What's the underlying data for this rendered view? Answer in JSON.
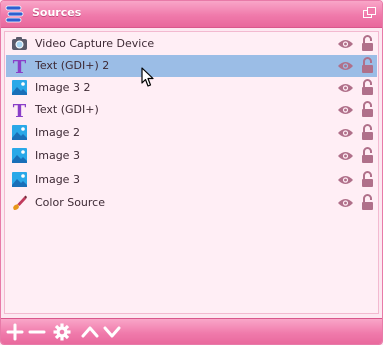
{
  "dock": {
    "title": "Sources"
  },
  "colors": {
    "accent": "#f07aab",
    "panel_bg": "#ffeef5",
    "selection": "#9bbde6",
    "icon_mauve": "#b0708a"
  },
  "sources": [
    {
      "name": "Video Capture Device",
      "type": "camera-icon",
      "selected": false
    },
    {
      "name": "Text (GDI+) 2",
      "type": "text-gdi-icon",
      "selected": true
    },
    {
      "name": "Image 3 2",
      "type": "image-icon",
      "selected": false
    },
    {
      "name": "Text (GDI+)",
      "type": "text-gdi-icon",
      "selected": false
    },
    {
      "name": "Image 2",
      "type": "image-icon",
      "selected": false
    },
    {
      "name": "Image 3",
      "type": "image-icon",
      "selected": false
    },
    {
      "name": "Image 3",
      "type": "image-icon",
      "selected": false
    },
    {
      "name": "Color Source",
      "type": "brush-icon",
      "selected": false
    }
  ],
  "toolbar": {
    "buttons": [
      "add-icon",
      "remove-icon",
      "gear-icon",
      "move-up-icon",
      "move-down-icon"
    ]
  }
}
